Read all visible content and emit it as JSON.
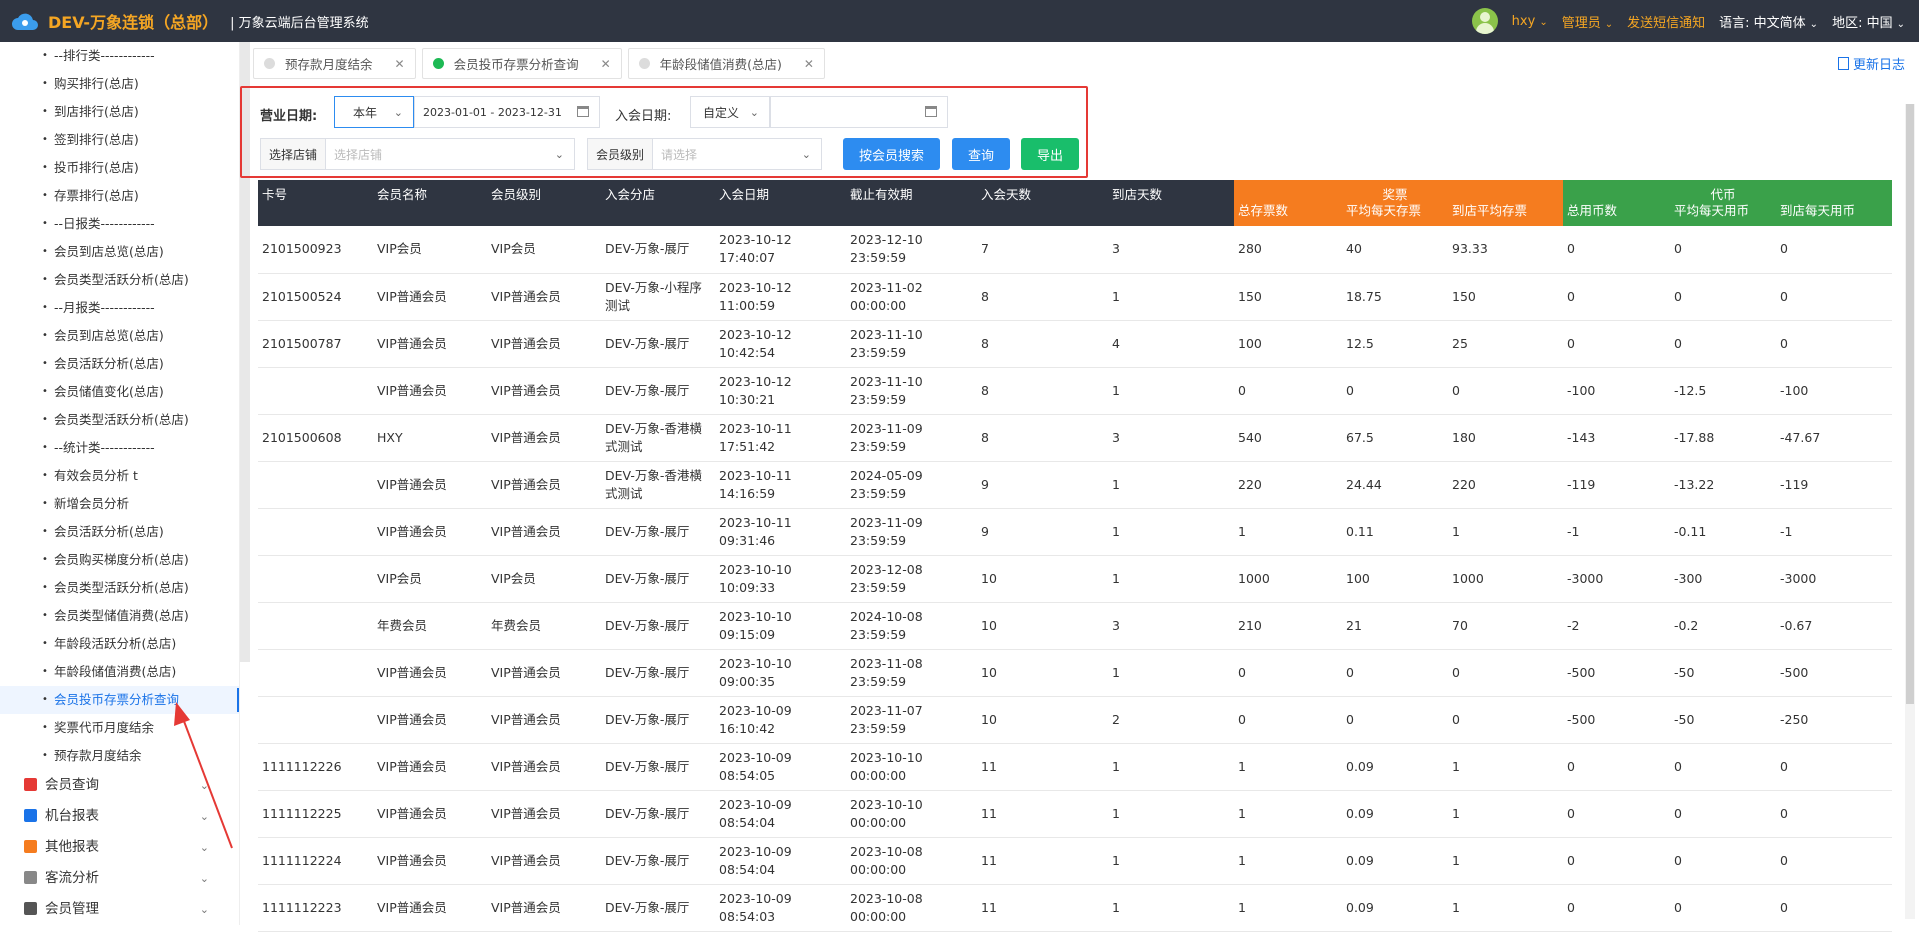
{
  "header": {
    "brand": "DEV-万象连锁（总部）",
    "system_name": "| 万象云端后台管理系统",
    "user": "hxy",
    "role": "管理员",
    "sms_link": "发送短信通知",
    "language_label": "语言:",
    "language_value": "中文简体",
    "region_label": "地区:",
    "region_value": "中国"
  },
  "sidebar": {
    "items": [
      "--排行类------------",
      "购买排行(总店)",
      "到店排行(总店)",
      "签到排行(总店)",
      "投币排行(总店)",
      "存票排行(总店)",
      "--日报类------------",
      "会员到店总览(总店)",
      "会员类型活跃分析(总店)",
      "--月报类------------",
      "会员到店总览(总店)",
      "会员活跃分析(总店)",
      "会员储值变化(总店)",
      "会员类型活跃分析(总店)",
      "--统计类------------",
      "有效会员分析 t",
      "新增会员分析",
      "会员活跃分析(总店)",
      "会员购买梯度分析(总店)",
      "会员类型活跃分析(总店)",
      "会员类型储值消费(总店)",
      "年龄段活跃分析(总店)",
      "年龄段储值消费(总店)",
      "会员投币存票分析查询",
      "奖票代币月度结余",
      "预存款月度结余"
    ],
    "groups": [
      {
        "label": "会员查询",
        "color": "#e53935"
      },
      {
        "label": "机台报表",
        "color": "#1a73e8"
      },
      {
        "label": "其他报表",
        "color": "#f57c1f"
      },
      {
        "label": "客流分析",
        "color": "#888888"
      },
      {
        "label": "会员管理",
        "color": "#555555"
      }
    ]
  },
  "tabs": [
    {
      "label": "预存款月度结余",
      "active": false
    },
    {
      "label": "会员投币存票分析查询",
      "active": true
    },
    {
      "label": "年龄段储值消费(总店)",
      "active": false
    }
  ],
  "changelog": "更新日志",
  "filter": {
    "biz_date_label": "营业日期:",
    "biz_date_mode": "本年",
    "biz_date_range": "2023-01-01 - 2023-12-31",
    "join_date_label": "入会日期:",
    "join_date_mode": "自定义",
    "store_label": "选择店铺",
    "store_placeholder": "选择店铺",
    "level_label": "会员级别",
    "level_placeholder": "请选择",
    "search_member_btn": "按会员搜索",
    "query_btn": "查询",
    "export_btn": "导出"
  },
  "table": {
    "headers": [
      "卡号",
      "会员名称",
      "会员级别",
      "入会分店",
      "入会日期",
      "截止有效期",
      "入会天数",
      "到店天数"
    ],
    "group_ticket": "奖票",
    "ticket_headers": [
      "总存票数",
      "平均每天存票",
      "到店平均存票"
    ],
    "group_coin": "代币",
    "coin_headers": [
      "总用币数",
      "平均每天用币",
      "到店每天用币"
    ],
    "rows": [
      [
        "2101500923",
        "VIP会员",
        "VIP会员",
        "DEV-万象-展厅",
        "2023-10-12\n17:40:07",
        "2023-12-10\n23:59:59",
        "7",
        "3",
        "280",
        "40",
        "93.33",
        "0",
        "0",
        "0"
      ],
      [
        "2101500524",
        "VIP普通会员",
        "VIP普通会员",
        "DEV-万象-小程序\n测试",
        "2023-10-12\n11:00:59",
        "2023-11-02\n00:00:00",
        "8",
        "1",
        "150",
        "18.75",
        "150",
        "0",
        "0",
        "0"
      ],
      [
        "2101500787",
        "VIP普通会员",
        "VIP普通会员",
        "DEV-万象-展厅",
        "2023-10-12\n10:42:54",
        "2023-11-10\n23:59:59",
        "8",
        "4",
        "100",
        "12.5",
        "25",
        "0",
        "0",
        "0"
      ],
      [
        "",
        "VIP普通会员",
        "VIP普通会员",
        "DEV-万象-展厅",
        "2023-10-12\n10:30:21",
        "2023-11-10\n23:59:59",
        "8",
        "1",
        "0",
        "0",
        "0",
        "-100",
        "-12.5",
        "-100"
      ],
      [
        "2101500608",
        "HXY",
        "VIP普通会员",
        "DEV-万象-香港横\n式测试",
        "2023-10-11\n17:51:42",
        "2023-11-09\n23:59:59",
        "8",
        "3",
        "540",
        "67.5",
        "180",
        "-143",
        "-17.88",
        "-47.67"
      ],
      [
        "",
        "VIP普通会员",
        "VIP普通会员",
        "DEV-万象-香港横\n式测试",
        "2023-10-11\n14:16:59",
        "2024-05-09\n23:59:59",
        "9",
        "1",
        "220",
        "24.44",
        "220",
        "-119",
        "-13.22",
        "-119"
      ],
      [
        "",
        "VIP普通会员",
        "VIP普通会员",
        "DEV-万象-展厅",
        "2023-10-11\n09:31:46",
        "2023-11-09\n23:59:59",
        "9",
        "1",
        "1",
        "0.11",
        "1",
        "-1",
        "-0.11",
        "-1"
      ],
      [
        "",
        "VIP会员",
        "VIP会员",
        "DEV-万象-展厅",
        "2023-10-10\n10:09:33",
        "2023-12-08\n23:59:59",
        "10",
        "1",
        "1000",
        "100",
        "1000",
        "-3000",
        "-300",
        "-3000"
      ],
      [
        "",
        "年费会员",
        "年费会员",
        "DEV-万象-展厅",
        "2023-10-10\n09:15:09",
        "2024-10-08\n23:59:59",
        "10",
        "3",
        "210",
        "21",
        "70",
        "-2",
        "-0.2",
        "-0.67"
      ],
      [
        "",
        "VIP普通会员",
        "VIP普通会员",
        "DEV-万象-展厅",
        "2023-10-10\n09:00:35",
        "2023-11-08\n23:59:59",
        "10",
        "1",
        "0",
        "0",
        "0",
        "-500",
        "-50",
        "-500"
      ],
      [
        "",
        "VIP普通会员",
        "VIP普通会员",
        "DEV-万象-展厅",
        "2023-10-09\n16:10:42",
        "2023-11-07\n23:59:59",
        "10",
        "2",
        "0",
        "0",
        "0",
        "-500",
        "-50",
        "-250"
      ],
      [
        "1111112226",
        "VIP普通会员",
        "VIP普通会员",
        "DEV-万象-展厅",
        "2023-10-09\n08:54:05",
        "2023-10-10\n00:00:00",
        "11",
        "1",
        "1",
        "0.09",
        "1",
        "0",
        "0",
        "0"
      ],
      [
        "1111112225",
        "VIP普通会员",
        "VIP普通会员",
        "DEV-万象-展厅",
        "2023-10-09\n08:54:04",
        "2023-10-10\n00:00:00",
        "11",
        "1",
        "1",
        "0.09",
        "1",
        "0",
        "0",
        "0"
      ],
      [
        "1111112224",
        "VIP普通会员",
        "VIP普通会员",
        "DEV-万象-展厅",
        "2023-10-09\n08:54:04",
        "2023-10-08\n00:00:00",
        "11",
        "1",
        "1",
        "0.09",
        "1",
        "0",
        "0",
        "0"
      ],
      [
        "1111112223",
        "VIP普通会员",
        "VIP普通会员",
        "DEV-万象-展厅",
        "2023-10-09\n08:54:03",
        "2023-10-08\n00:00:00",
        "11",
        "1",
        "1",
        "0.09",
        "1",
        "0",
        "0",
        "0"
      ]
    ]
  }
}
